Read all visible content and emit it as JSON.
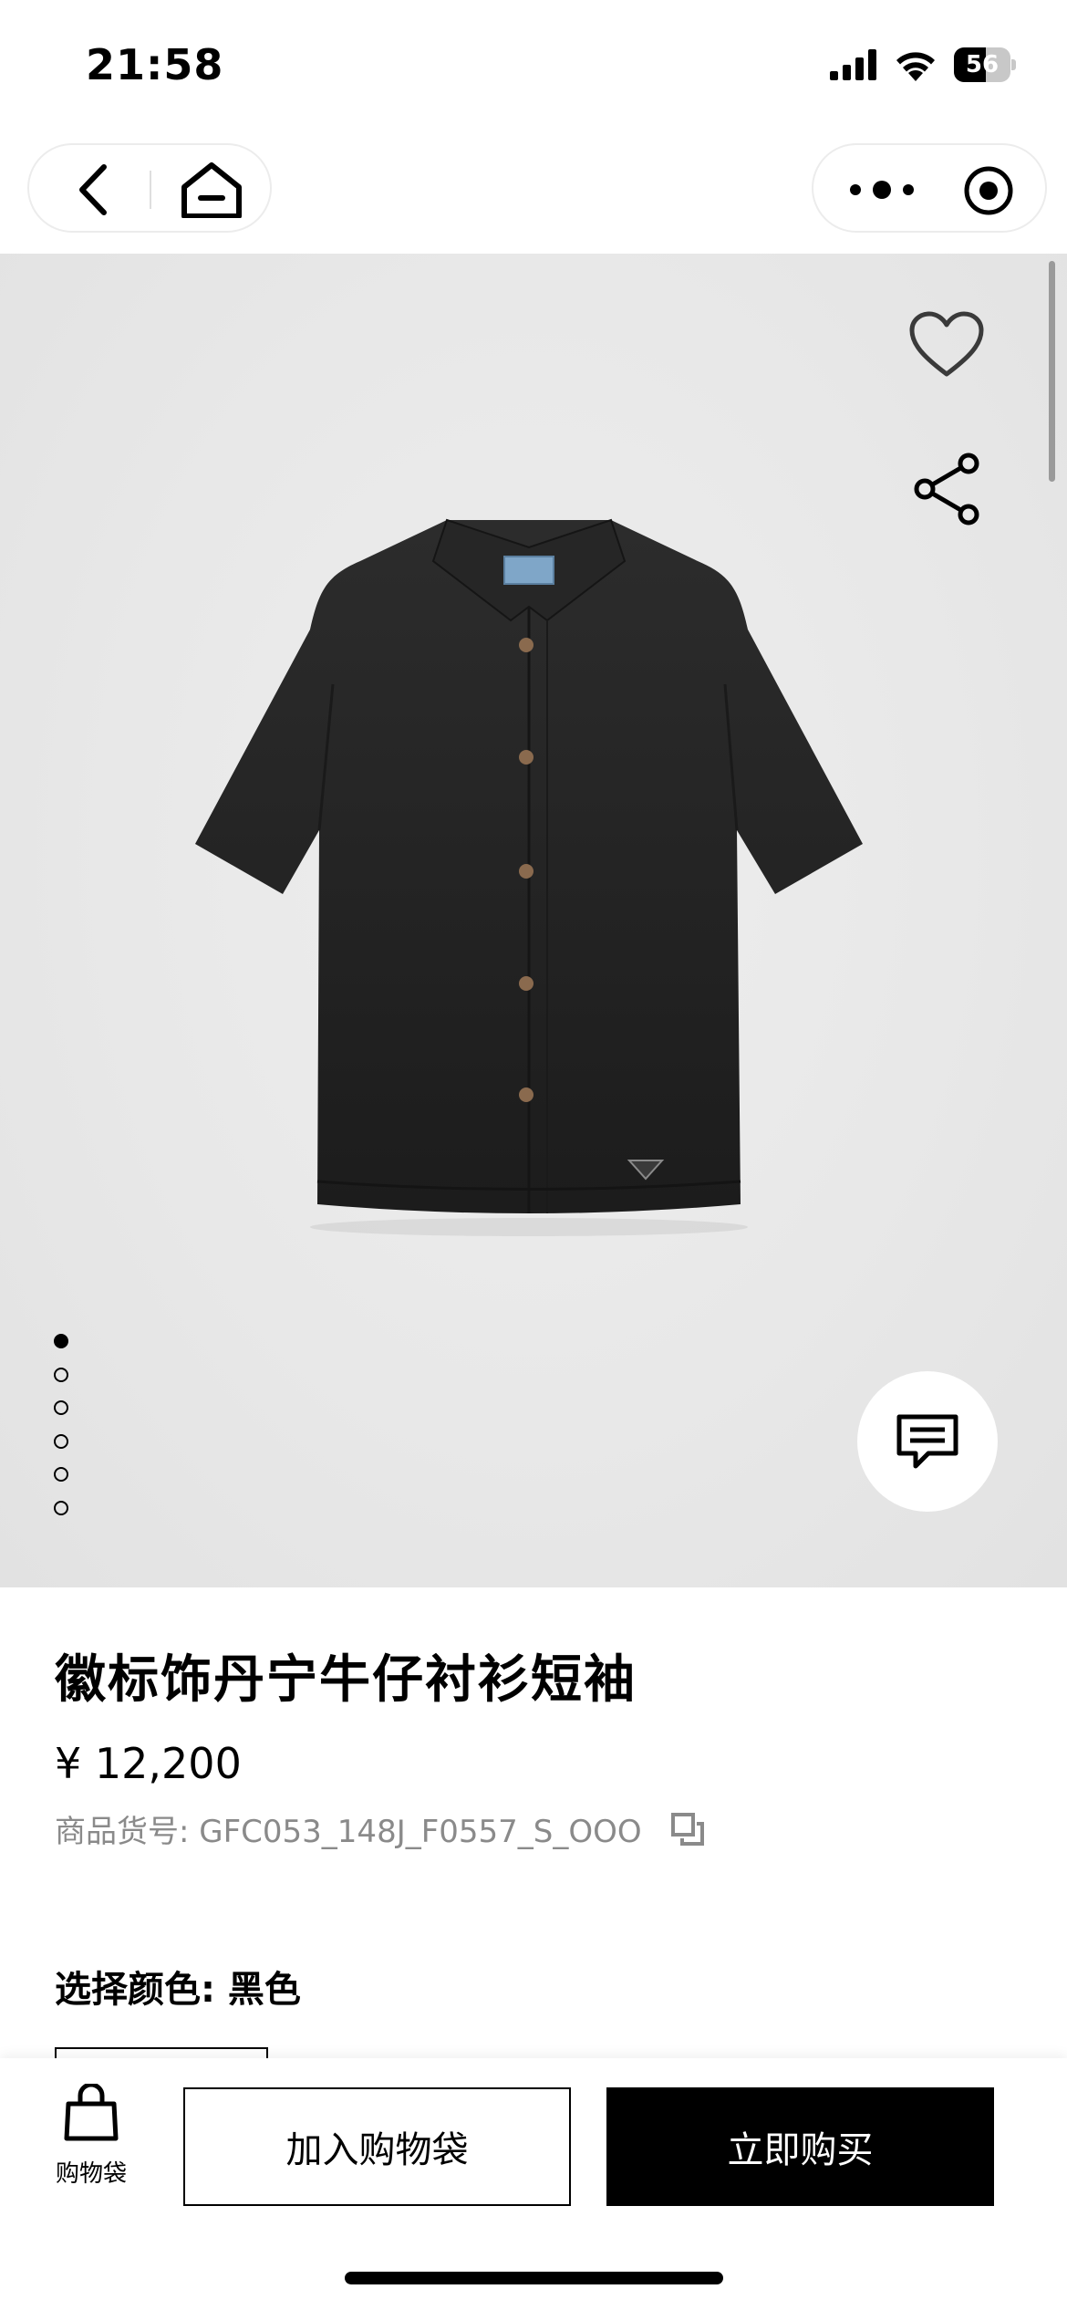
{
  "status_bar": {
    "time": "21:58",
    "battery_level": "56",
    "battery_fraction": 0.56
  },
  "nav": {
    "back_icon": "chevron-left-icon",
    "home_icon": "home-icon",
    "more_icon": "more-dots-icon",
    "close_icon": "target-circle-icon"
  },
  "gallery": {
    "image_count": 6,
    "active_index": 0,
    "image_subject": "black short-sleeve denim shirt",
    "favorite_icon": "heart-icon",
    "share_icon": "share-icon",
    "chat_icon": "chat-icon"
  },
  "product": {
    "title": "徽标饰丹宁牛仔衬衫短袖",
    "price": "¥ 12,200",
    "sku_label": "商品货号: GFC053_148J_F0557_S_OOO",
    "color_label": "选择颜色: 黑色"
  },
  "bottom_bar": {
    "bag_label": "购物袋",
    "add_to_bag": "加入购物袋",
    "buy_now": "立即购买"
  },
  "colors": {
    "accent": "#000000",
    "background": "#ffffff",
    "gallery_bg": "#e9e9e9",
    "muted_text": "#8a8a8a"
  }
}
